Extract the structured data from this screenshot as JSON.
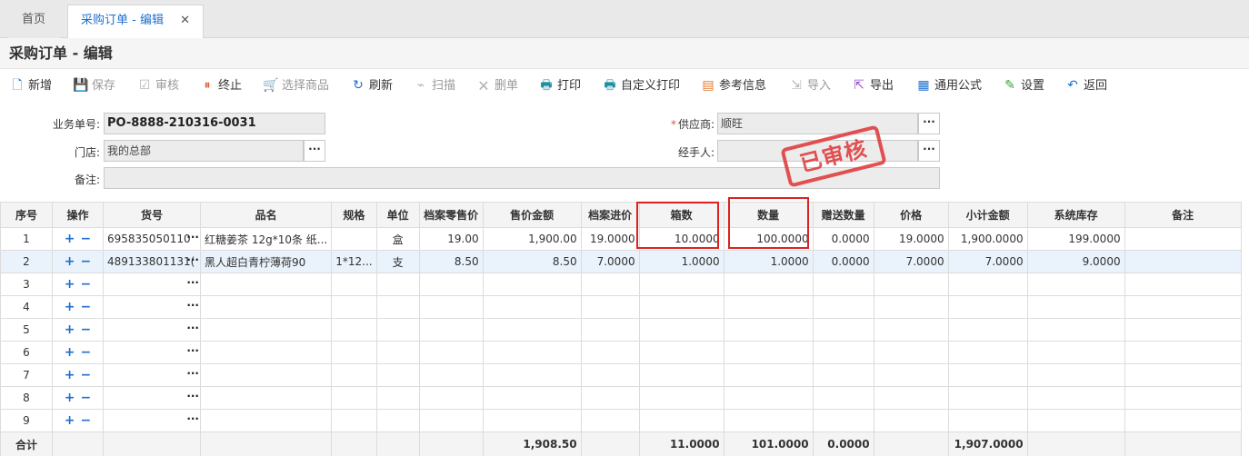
{
  "tabs": {
    "home": "首页",
    "active": "采购订单 - 编辑",
    "close": "✕"
  },
  "page_title": "采购订单 - 编辑",
  "toolbar": [
    {
      "icon": "add-file-icon",
      "glyph": "🗋",
      "label": "新增",
      "color": "#1f6fd0",
      "disabled": false
    },
    {
      "icon": "save-icon",
      "glyph": "💾",
      "label": "保存",
      "color": "#3aa03a",
      "disabled": true
    },
    {
      "icon": "audit-icon",
      "glyph": "☑",
      "label": "审核",
      "color": "#e08a2c",
      "disabled": true
    },
    {
      "icon": "stop-icon",
      "glyph": "⏸",
      "label": "终止",
      "color": "#e05a2c",
      "disabled": false
    },
    {
      "icon": "cart-icon",
      "glyph": "🛒",
      "label": "选择商品",
      "color": "#888",
      "disabled": true
    },
    {
      "icon": "refresh-icon",
      "glyph": "↻",
      "label": "刷新",
      "color": "#1f6fd0",
      "disabled": false
    },
    {
      "icon": "scan-icon",
      "glyph": "⌁",
      "label": "扫描",
      "color": "#3a8fd0",
      "disabled": true
    },
    {
      "icon": "delete-icon",
      "glyph": "🗙",
      "label": "删单",
      "color": "#d9534f",
      "disabled": true
    },
    {
      "icon": "print-icon",
      "glyph": "🖶",
      "label": "打印",
      "color": "#1f8fa0",
      "disabled": false
    },
    {
      "icon": "custom-print-icon",
      "glyph": "🖶",
      "label": "自定义打印",
      "color": "#1f8fa0",
      "disabled": false
    },
    {
      "icon": "info-icon",
      "glyph": "▤",
      "label": "参考信息",
      "color": "#e07a2c",
      "disabled": false
    },
    {
      "icon": "import-icon",
      "glyph": "⇲",
      "label": "导入",
      "color": "#3aa03a",
      "disabled": true
    },
    {
      "icon": "export-icon",
      "glyph": "⇱",
      "label": "导出",
      "color": "#9a4ad0",
      "disabled": false
    },
    {
      "icon": "formula-icon",
      "glyph": "▦",
      "label": "通用公式",
      "color": "#1f6fd0",
      "disabled": false
    },
    {
      "icon": "settings-icon",
      "glyph": "✎",
      "label": "设置",
      "color": "#3aa03a",
      "disabled": false
    },
    {
      "icon": "back-icon",
      "glyph": "↶",
      "label": "返回",
      "color": "#1f6fd0",
      "disabled": false
    }
  ],
  "form": {
    "order_no_label": "业务单号:",
    "order_no": "PO-8888-210316-0031",
    "store_label": "门店:",
    "store": "我的总部",
    "remark_label": "备注:",
    "remark": "",
    "supplier_req": "*",
    "supplier_label": "供应商:",
    "supplier": "顺旺",
    "handler_label": "经手人:",
    "handler": "",
    "more": "···"
  },
  "stamp": "已审核",
  "grid": {
    "columns": [
      "序号",
      "操作",
      "货号",
      "品名",
      "规格",
      "单位",
      "档案零售价",
      "售价金额",
      "档案进价",
      "箱数",
      "数量",
      "赠送数量",
      "价格",
      "小计金额",
      "系统库存",
      "备注"
    ],
    "rows": [
      {
        "no": "1",
        "sku": "695835050110",
        "name": "红糖姜茶 12g*10条 纸...",
        "spec": "",
        "unit": "盒",
        "retail": "19.00",
        "retail_amt": "1,900.00",
        "cost": "19.0000",
        "boxes": "10.0000",
        "qty": "100.0000",
        "gift": "0.0000",
        "price": "19.0000",
        "subtotal": "1,900.0000",
        "stock": "199.0000",
        "remark": ""
      },
      {
        "no": "2",
        "sku": "489133801131(",
        "name": "黑人超白青柠薄荷90",
        "spec": "1*12...",
        "unit": "支",
        "retail": "8.50",
        "retail_amt": "8.50",
        "cost": "7.0000",
        "boxes": "1.0000",
        "qty": "1.0000",
        "gift": "0.0000",
        "price": "7.0000",
        "subtotal": "7.0000",
        "stock": "9.0000",
        "remark": ""
      },
      {
        "no": "3",
        "sku": "",
        "name": "",
        "spec": "",
        "unit": "",
        "retail": "",
        "retail_amt": "",
        "cost": "",
        "boxes": "",
        "qty": "",
        "gift": "",
        "price": "",
        "subtotal": "",
        "stock": "",
        "remark": ""
      },
      {
        "no": "4",
        "sku": "",
        "name": "",
        "spec": "",
        "unit": "",
        "retail": "",
        "retail_amt": "",
        "cost": "",
        "boxes": "",
        "qty": "",
        "gift": "",
        "price": "",
        "subtotal": "",
        "stock": "",
        "remark": ""
      },
      {
        "no": "5",
        "sku": "",
        "name": "",
        "spec": "",
        "unit": "",
        "retail": "",
        "retail_amt": "",
        "cost": "",
        "boxes": "",
        "qty": "",
        "gift": "",
        "price": "",
        "subtotal": "",
        "stock": "",
        "remark": ""
      },
      {
        "no": "6",
        "sku": "",
        "name": "",
        "spec": "",
        "unit": "",
        "retail": "",
        "retail_amt": "",
        "cost": "",
        "boxes": "",
        "qty": "",
        "gift": "",
        "price": "",
        "subtotal": "",
        "stock": "",
        "remark": ""
      },
      {
        "no": "7",
        "sku": "",
        "name": "",
        "spec": "",
        "unit": "",
        "retail": "",
        "retail_amt": "",
        "cost": "",
        "boxes": "",
        "qty": "",
        "gift": "",
        "price": "",
        "subtotal": "",
        "stock": "",
        "remark": ""
      },
      {
        "no": "8",
        "sku": "",
        "name": "",
        "spec": "",
        "unit": "",
        "retail": "",
        "retail_amt": "",
        "cost": "",
        "boxes": "",
        "qty": "",
        "gift": "",
        "price": "",
        "subtotal": "",
        "stock": "",
        "remark": ""
      },
      {
        "no": "9",
        "sku": "",
        "name": "",
        "spec": "",
        "unit": "",
        "retail": "",
        "retail_amt": "",
        "cost": "",
        "boxes": "",
        "qty": "",
        "gift": "",
        "price": "",
        "subtotal": "",
        "stock": "",
        "remark": ""
      }
    ],
    "footer": {
      "label": "合计",
      "retail_amt": "1,908.50",
      "boxes": "11.0000",
      "qty": "101.0000",
      "gift": "0.0000",
      "subtotal": "1,907.0000"
    },
    "plus": "+",
    "minus": "−",
    "dots": "···"
  }
}
